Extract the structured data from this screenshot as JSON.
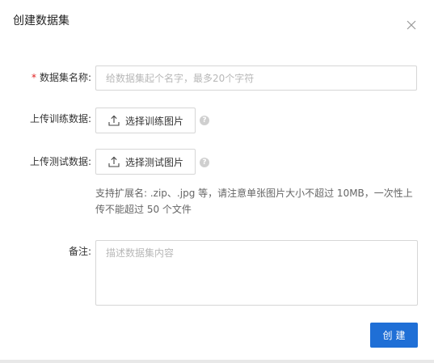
{
  "dialog": {
    "title": "创建数据集",
    "close_icon": "close-icon"
  },
  "form": {
    "name": {
      "required_mark": "*",
      "label": "数据集名称:",
      "placeholder": "给数据集起个名字，最多20个字符",
      "value": ""
    },
    "train_upload": {
      "label": "上传训练数据:",
      "button_label": "选择训练图片",
      "icon": "upload-icon",
      "help": "?"
    },
    "test_upload": {
      "label": "上传测试数据:",
      "button_label": "选择测试图片",
      "icon": "upload-icon",
      "help": "?"
    },
    "hint": "支持扩展名: .zip、.jpg 等，请注意单张图片大小不超过 10MB，一次性上传不能超过 50 个文件",
    "remark": {
      "label": "备注:",
      "placeholder": "描述数据集内容",
      "value": ""
    }
  },
  "footer": {
    "submit_label": "创建"
  },
  "colors": {
    "primary": "#1f6fd6",
    "required": "#e02020",
    "border": "#d6d6d6",
    "placeholder": "#b8b8b8"
  }
}
